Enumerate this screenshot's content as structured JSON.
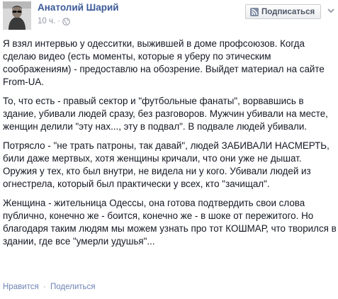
{
  "post": {
    "author": "Анатолий Шарий",
    "timestamp": "10 ч.",
    "separator": "·",
    "privacy_icon": "globe-icon",
    "subscribe_label": "Подписаться",
    "subscribe_icon": "rss-icon",
    "menu_icon": "chevron-down-icon",
    "paragraphs": [
      "Я взял интервью у одесситки, выжившей в доме профсоюзов. Когда сделаю видео (есть моменты, которые я уберу по этическим соображениям) - предоставлю на обозрение. Выйдет материал на сайте From-UA.",
      "То, что есть - правый сектор и \"футбольные фанаты\", ворвавшись в здание, убивали людей сразу, без разговоров. Мужчин убивали на месте, женщин делили \"эту нах..., эту в подвал\". В подвале людей убивали.",
      "Потрясло - \"не трать патроны, так давай\", людей ЗАБИВАЛИ НАСМЕРТЬ, били даже мертвых, хотя женщины кричали, что они уже не дышат. Оружия у тех, кто был внутри, не видела ни у кого. Убивали людей из огнестрела, который был практически у всех, кто \"зачищал\".",
      "Женщина - жительница Одессы, она готова подтвердить свои слова публично, конечно же - боится, конечно же - в шоке от пережитого. Но благодаря таким людям мы можем узнать про тот КОШМАР, что творился в здании, где все \"умерли удушья\"..."
    ],
    "actions": {
      "like": "Нравится",
      "dot": "·",
      "share": "Поделиться"
    },
    "colors": {
      "link": "#3b5998",
      "action_link": "#6d84b4",
      "meta": "#9197a3",
      "text": "#141823"
    }
  }
}
